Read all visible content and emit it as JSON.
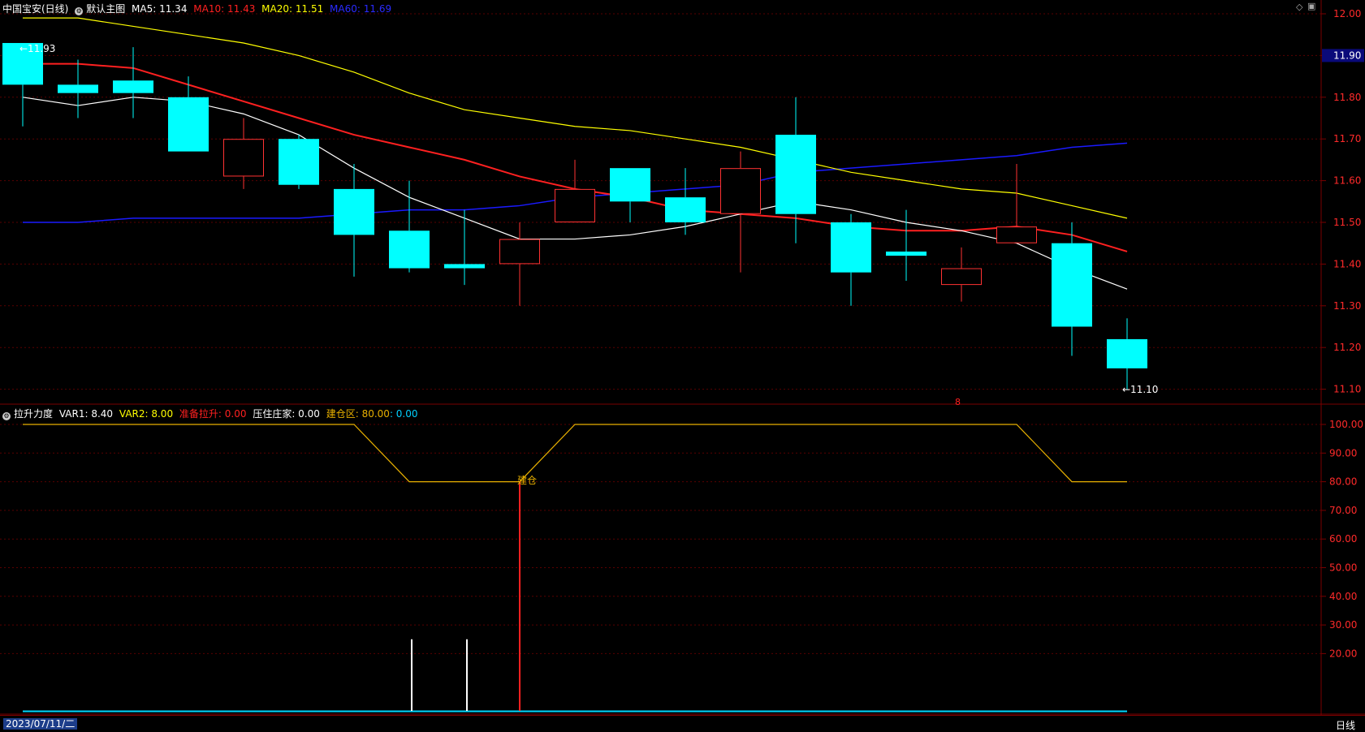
{
  "main_header": {
    "symbol": "中国宝安(日线)",
    "template": "默认主图",
    "ma5": "MA5: 11.34",
    "ma10": "MA10: 11.43",
    "ma20": "MA20: 11.51",
    "ma60": "MA60: 11.69"
  },
  "sub_header": {
    "name": "拉升力度",
    "var1": "VAR1: 8.40",
    "var2": "VAR2: 8.00",
    "ready": "准备拉升: 0.00",
    "press": "压住庄家: 0.00",
    "build": "建仓区: 80.00",
    "build_val2": ": 0.00"
  },
  "price_axis": {
    "ticks": [
      "12.00",
      "11.90",
      "11.80",
      "11.70",
      "11.60",
      "11.50",
      "11.40",
      "11.30",
      "11.20",
      "11.10"
    ],
    "highlight": "11.90"
  },
  "sub_axis": {
    "ticks": [
      "100.00",
      "90.00",
      "80.00",
      "70.00",
      "60.00",
      "50.00",
      "40.00",
      "30.00",
      "20.00"
    ]
  },
  "annotations": {
    "high_label": "11.93",
    "low_label": "11.10",
    "build_text": "建仓",
    "marker_main": "8",
    "marker_bottom": "8"
  },
  "bottom_bar": {
    "date": "2023/07/11/二",
    "period": "日线"
  },
  "colors": {
    "up": "#ff3232",
    "down": "#00ffff",
    "ma5": "#ffffff",
    "ma10": "#ff2020",
    "ma20": "#ffff00",
    "ma60": "#1a1aff",
    "build_line": "#e8b000"
  },
  "chart_data": [
    {
      "type": "candlestick",
      "price_range": [
        11.06,
        12.02
      ],
      "candles": [
        {
          "o": 11.93,
          "h": 11.93,
          "l": 11.73,
          "c": 11.83
        },
        {
          "o": 11.83,
          "h": 11.89,
          "l": 11.75,
          "c": 11.81
        },
        {
          "o": 11.84,
          "h": 11.92,
          "l": 11.75,
          "c": 11.81
        },
        {
          "o": 11.8,
          "h": 11.85,
          "l": 11.67,
          "c": 11.67
        },
        {
          "o": 11.61,
          "h": 11.75,
          "l": 11.58,
          "c": 11.7
        },
        {
          "o": 11.7,
          "h": 11.71,
          "l": 11.58,
          "c": 11.59
        },
        {
          "o": 11.58,
          "h": 11.64,
          "l": 11.37,
          "c": 11.47
        },
        {
          "o": 11.48,
          "h": 11.6,
          "l": 11.38,
          "c": 11.39
        },
        {
          "o": 11.4,
          "h": 11.53,
          "l": 11.35,
          "c": 11.39
        },
        {
          "o": 11.4,
          "h": 11.5,
          "l": 11.3,
          "c": 11.46
        },
        {
          "o": 11.5,
          "h": 11.65,
          "l": 11.5,
          "c": 11.58
        },
        {
          "o": 11.63,
          "h": 11.63,
          "l": 11.5,
          "c": 11.55
        },
        {
          "o": 11.56,
          "h": 11.63,
          "l": 11.47,
          "c": 11.5
        },
        {
          "o": 11.52,
          "h": 11.67,
          "l": 11.38,
          "c": 11.63
        },
        {
          "o": 11.71,
          "h": 11.8,
          "l": 11.45,
          "c": 11.52
        },
        {
          "o": 11.5,
          "h": 11.52,
          "l": 11.3,
          "c": 11.38
        },
        {
          "o": 11.43,
          "h": 11.53,
          "l": 11.36,
          "c": 11.42
        },
        {
          "o": 11.35,
          "h": 11.44,
          "l": 11.31,
          "c": 11.39
        },
        {
          "o": 11.45,
          "h": 11.64,
          "l": 11.45,
          "c": 11.49
        },
        {
          "o": 11.45,
          "h": 11.5,
          "l": 11.18,
          "c": 11.25
        },
        {
          "o": 11.22,
          "h": 11.27,
          "l": 11.1,
          "c": 11.15
        }
      ],
      "ma5": [
        11.8,
        11.78,
        11.8,
        11.79,
        11.76,
        11.71,
        11.63,
        11.56,
        11.51,
        11.46,
        11.46,
        11.47,
        11.49,
        11.52,
        11.55,
        11.53,
        11.5,
        11.48,
        11.45,
        11.39,
        11.34
      ],
      "ma10": [
        11.88,
        11.88,
        11.87,
        11.83,
        11.79,
        11.75,
        11.71,
        11.68,
        11.65,
        11.61,
        11.58,
        11.56,
        11.53,
        11.52,
        11.51,
        11.49,
        11.48,
        11.48,
        11.49,
        11.47,
        11.43
      ],
      "ma20": [
        11.99,
        11.99,
        11.97,
        11.95,
        11.93,
        11.9,
        11.86,
        11.81,
        11.77,
        11.75,
        11.73,
        11.72,
        11.7,
        11.68,
        11.65,
        11.62,
        11.6,
        11.58,
        11.57,
        11.54,
        11.51
      ],
      "ma60": [
        11.5,
        11.5,
        11.51,
        11.51,
        11.51,
        11.51,
        11.52,
        11.53,
        11.53,
        11.54,
        11.56,
        11.57,
        11.58,
        11.59,
        11.62,
        11.63,
        11.64,
        11.65,
        11.66,
        11.68,
        11.69
      ]
    },
    {
      "type": "line",
      "range": [
        0,
        100
      ],
      "build_zone": [
        100,
        100,
        100,
        100,
        100,
        100,
        100,
        80,
        80,
        80,
        100,
        100,
        100,
        100,
        100,
        100,
        100,
        100,
        100,
        80,
        80
      ],
      "white_spikes": [
        {
          "index": 7,
          "value": 25
        },
        {
          "index": 8,
          "value": 25
        }
      ],
      "red_spike": {
        "index": 9,
        "value": 80
      },
      "baseline": 0
    }
  ]
}
